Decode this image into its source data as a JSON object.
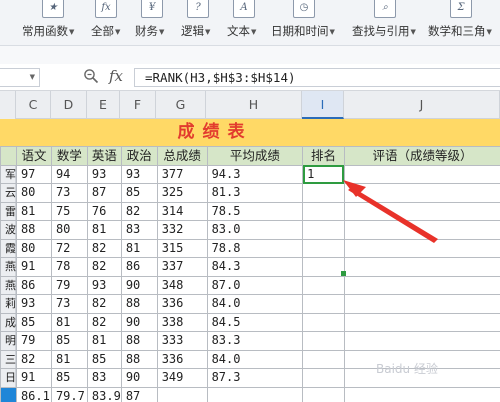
{
  "ribbon": {
    "items": [
      {
        "label": "常用函数",
        "icon": "fx-star-icon",
        "glyph": "★"
      },
      {
        "label": "全部",
        "icon": "fx-icon",
        "glyph": "fx"
      },
      {
        "label": "财务",
        "icon": "yen-icon",
        "glyph": "¥"
      },
      {
        "label": "逻辑",
        "icon": "logic-icon",
        "glyph": "?"
      },
      {
        "label": "文本",
        "icon": "text-icon",
        "glyph": "A"
      },
      {
        "label": "日期和时间",
        "icon": "date-time-icon",
        "glyph": "◷"
      },
      {
        "label": "查找与引用",
        "icon": "lookup-icon",
        "glyph": "⌕"
      },
      {
        "label": "数学和三角",
        "icon": "math-icon",
        "glyph": "Σ"
      }
    ]
  },
  "formula_bar": {
    "fx_label": "fx",
    "formula": "=RANK(H3,$H$3:$H$14)"
  },
  "columns": [
    "C",
    "D",
    "E",
    "F",
    "G",
    "H",
    "I",
    "J"
  ],
  "selected_column": "I",
  "sheet_title": "成绩表",
  "headers": [
    "语文",
    "数学",
    "英语",
    "政治",
    "总成绩",
    "平均成绩",
    "排名",
    "评语（成绩等级）"
  ],
  "row_name_fragments": [
    "",
    "军",
    "云",
    "雷",
    "波",
    "霞",
    "燕",
    "燕",
    "莉",
    "成",
    "明",
    "三",
    "日",
    ""
  ],
  "rows": [
    [
      "97",
      "94",
      "93",
      "93",
      "377",
      "94.3",
      "1",
      ""
    ],
    [
      "80",
      "73",
      "87",
      "85",
      "325",
      "81.3",
      "",
      ""
    ],
    [
      "81",
      "75",
      "76",
      "82",
      "314",
      "78.5",
      "",
      ""
    ],
    [
      "88",
      "80",
      "81",
      "83",
      "332",
      "83.0",
      "",
      ""
    ],
    [
      "80",
      "72",
      "82",
      "81",
      "315",
      "78.8",
      "",
      ""
    ],
    [
      "91",
      "78",
      "82",
      "86",
      "337",
      "84.3",
      "",
      ""
    ],
    [
      "86",
      "79",
      "93",
      "90",
      "348",
      "87.0",
      "",
      ""
    ],
    [
      "93",
      "73",
      "82",
      "88",
      "336",
      "84.0",
      "",
      ""
    ],
    [
      "85",
      "81",
      "82",
      "90",
      "338",
      "84.5",
      "",
      ""
    ],
    [
      "79",
      "85",
      "81",
      "88",
      "333",
      "83.3",
      "",
      ""
    ],
    [
      "82",
      "81",
      "85",
      "88",
      "336",
      "84.0",
      "",
      ""
    ],
    [
      "91",
      "85",
      "83",
      "90",
      "349",
      "87.3",
      "",
      ""
    ],
    [
      "86.1",
      "79.7",
      "83.9",
      "87",
      "",
      "",
      "",
      ""
    ]
  ],
  "watermark": "Baidu 经验",
  "colors": {
    "title_fill": "#ffd966",
    "title_text": "#e23b2e",
    "header_fill": "#d6e6c8",
    "active_cell_border": "#2e9b40",
    "arrow": "#e8322a",
    "selected_row_marker": "#1f86d8"
  }
}
